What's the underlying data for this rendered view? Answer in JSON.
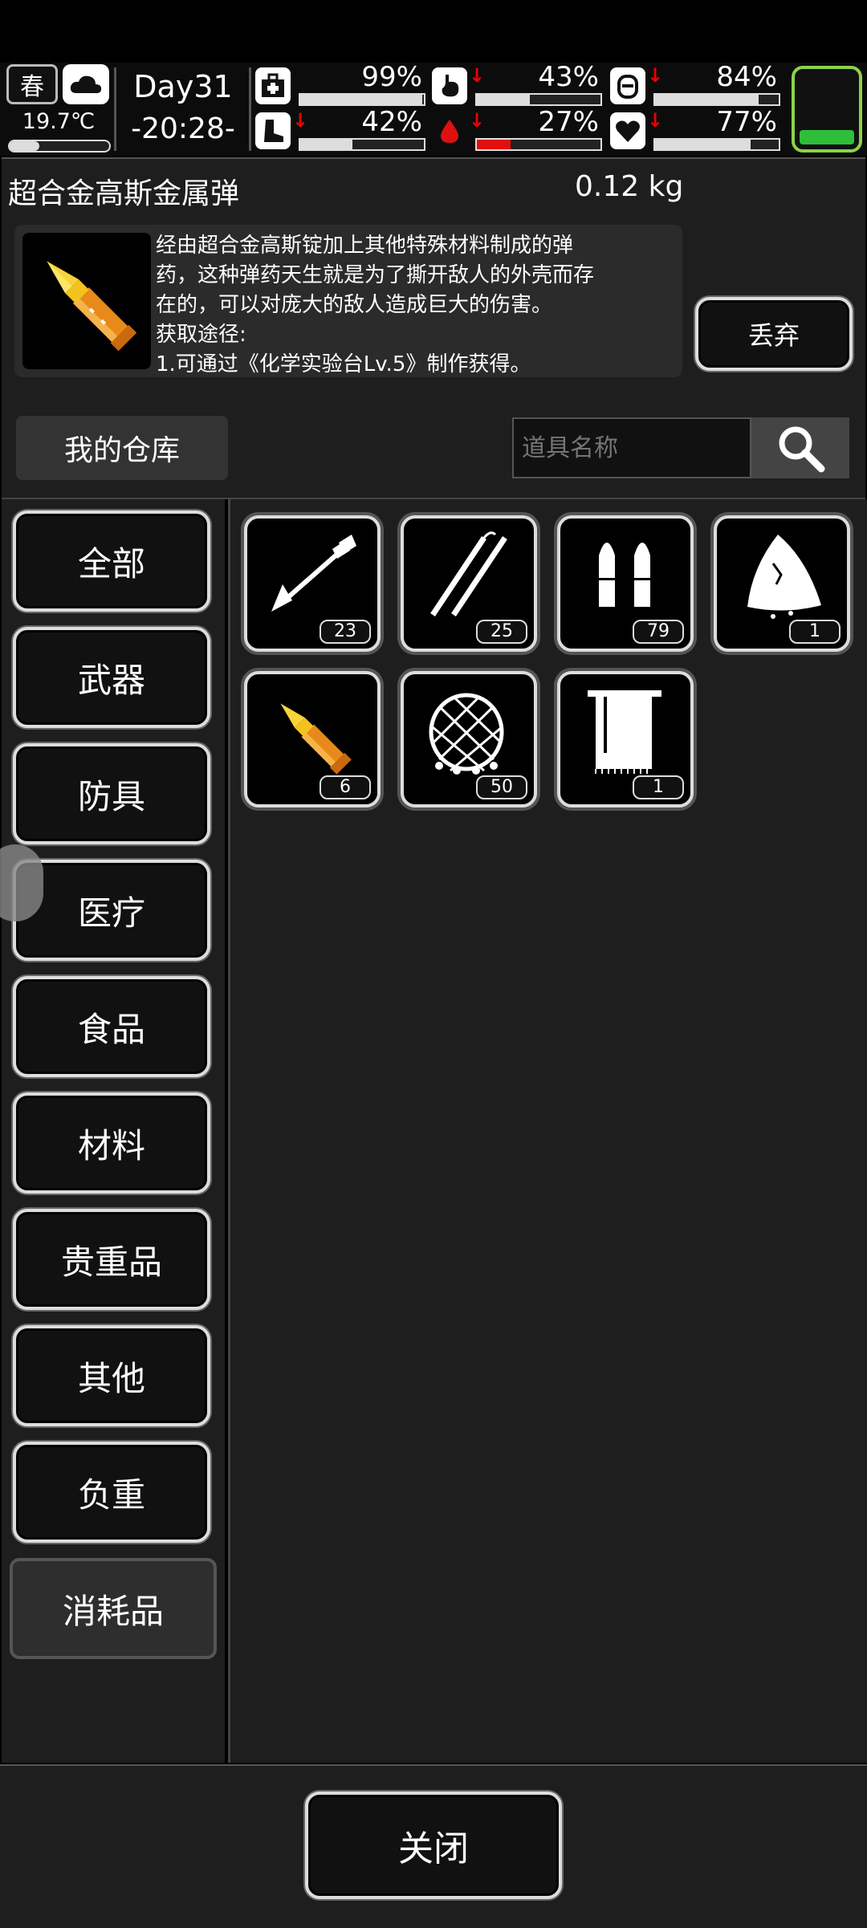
{
  "status": {
    "season": "春",
    "temperature": "19.7℃",
    "temperature_level": 0.3,
    "day": "Day31",
    "time": "-20:28-",
    "stats": [
      {
        "name": "health",
        "icon": "medkit-icon",
        "value": "99%",
        "level": 0.99,
        "down": false
      },
      {
        "name": "hunger",
        "icon": "stomach-icon",
        "value": "43%",
        "level": 0.43,
        "down": true
      },
      {
        "name": "water",
        "icon": "canteen-icon",
        "value": "84%",
        "level": 0.84,
        "down": true
      },
      {
        "name": "stamina",
        "icon": "boot-icon",
        "value": "42%",
        "level": 0.42,
        "down": true
      },
      {
        "name": "blood",
        "icon": "blood-drop-icon",
        "value": "27%",
        "level": 0.27,
        "down": true
      },
      {
        "name": "mood",
        "icon": "heart-icon",
        "value": "77%",
        "level": 0.77,
        "down": true
      }
    ],
    "battery_level": 0.2
  },
  "detail": {
    "name": "超合金高斯金属弹",
    "weight": "0.12 kg",
    "description": "经由超合金高斯锭加上其他特殊材料制成的弹\n药，这种弹药天生就是为了撕开敌人的外壳而存\n在的，可以对庞大的敌人造成巨大的伤害。\n获取途径:\n1.可通过《化学实验台Lv.5》制作获得。",
    "discard_label": "丢弃"
  },
  "warehouse": {
    "title": "我的仓库",
    "search_placeholder": "道具名称"
  },
  "categories": [
    "全部",
    "武器",
    "防具",
    "医疗",
    "食品",
    "材料",
    "贵重品",
    "其他",
    "负重",
    "消耗品"
  ],
  "active_category": "消耗品",
  "items": [
    {
      "icon": "arrow-icon",
      "count": "23"
    },
    {
      "icon": "tweezers-icon",
      "count": "25"
    },
    {
      "icon": "bullets-icon",
      "count": "79"
    },
    {
      "icon": "cloth-icon",
      "count": "1"
    },
    {
      "icon": "gauss-bullet-icon",
      "count": "6",
      "selected": true
    },
    {
      "icon": "net-icon",
      "count": "50"
    },
    {
      "icon": "towel-icon",
      "count": "1"
    }
  ],
  "footer": {
    "close_label": "关闭"
  }
}
